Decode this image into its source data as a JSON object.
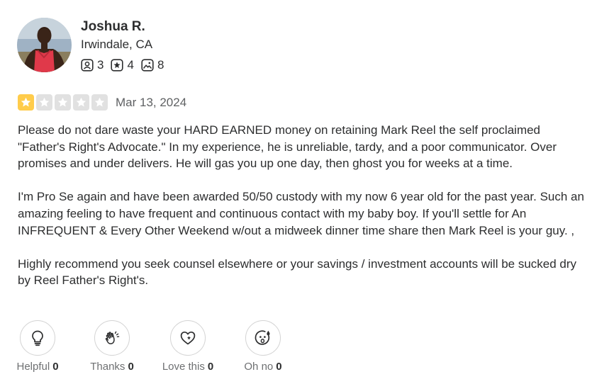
{
  "user": {
    "name": "Joshua R.",
    "location": "Irwindale, CA",
    "stats": {
      "friends": "3",
      "reviews": "4",
      "photos": "8"
    }
  },
  "rating": {
    "value": 1,
    "max": 5,
    "filled_color": "#ffcc4b",
    "empty_color": "#e1e1e1",
    "date": "Mar 13, 2024"
  },
  "body": {
    "paragraphs": [
      "Please do not dare waste your HARD EARNED money on retaining Mark Reel the self proclaimed \"Father's Right's Advocate.\" In my experience, he is unreliable, tardy, and a poor communicator. Over promises and under delivers. He will gas you up one day, then ghost you for weeks at a time.",
      "I'm Pro Se again and have been awarded 50/50 custody with my now 6 year old for the past year. Such an amazing feeling to have frequent and continuous contact with my baby boy. If you'll settle for An INFREQUENT & Every Other Weekend w/out a midweek dinner time share then Mark Reel is your guy. ,",
      "Highly recommend you seek counsel elsewhere or your savings / investment accounts will be sucked dry by Reel Father's Right's."
    ]
  },
  "reactions": [
    {
      "label": "Helpful",
      "count": "0",
      "icon": "lightbulb-icon"
    },
    {
      "label": "Thanks",
      "count": "0",
      "icon": "clapping-hands-icon"
    },
    {
      "label": "Love this",
      "count": "0",
      "icon": "heart-icon"
    },
    {
      "label": "Oh no",
      "count": "0",
      "icon": "sad-face-icon"
    }
  ]
}
